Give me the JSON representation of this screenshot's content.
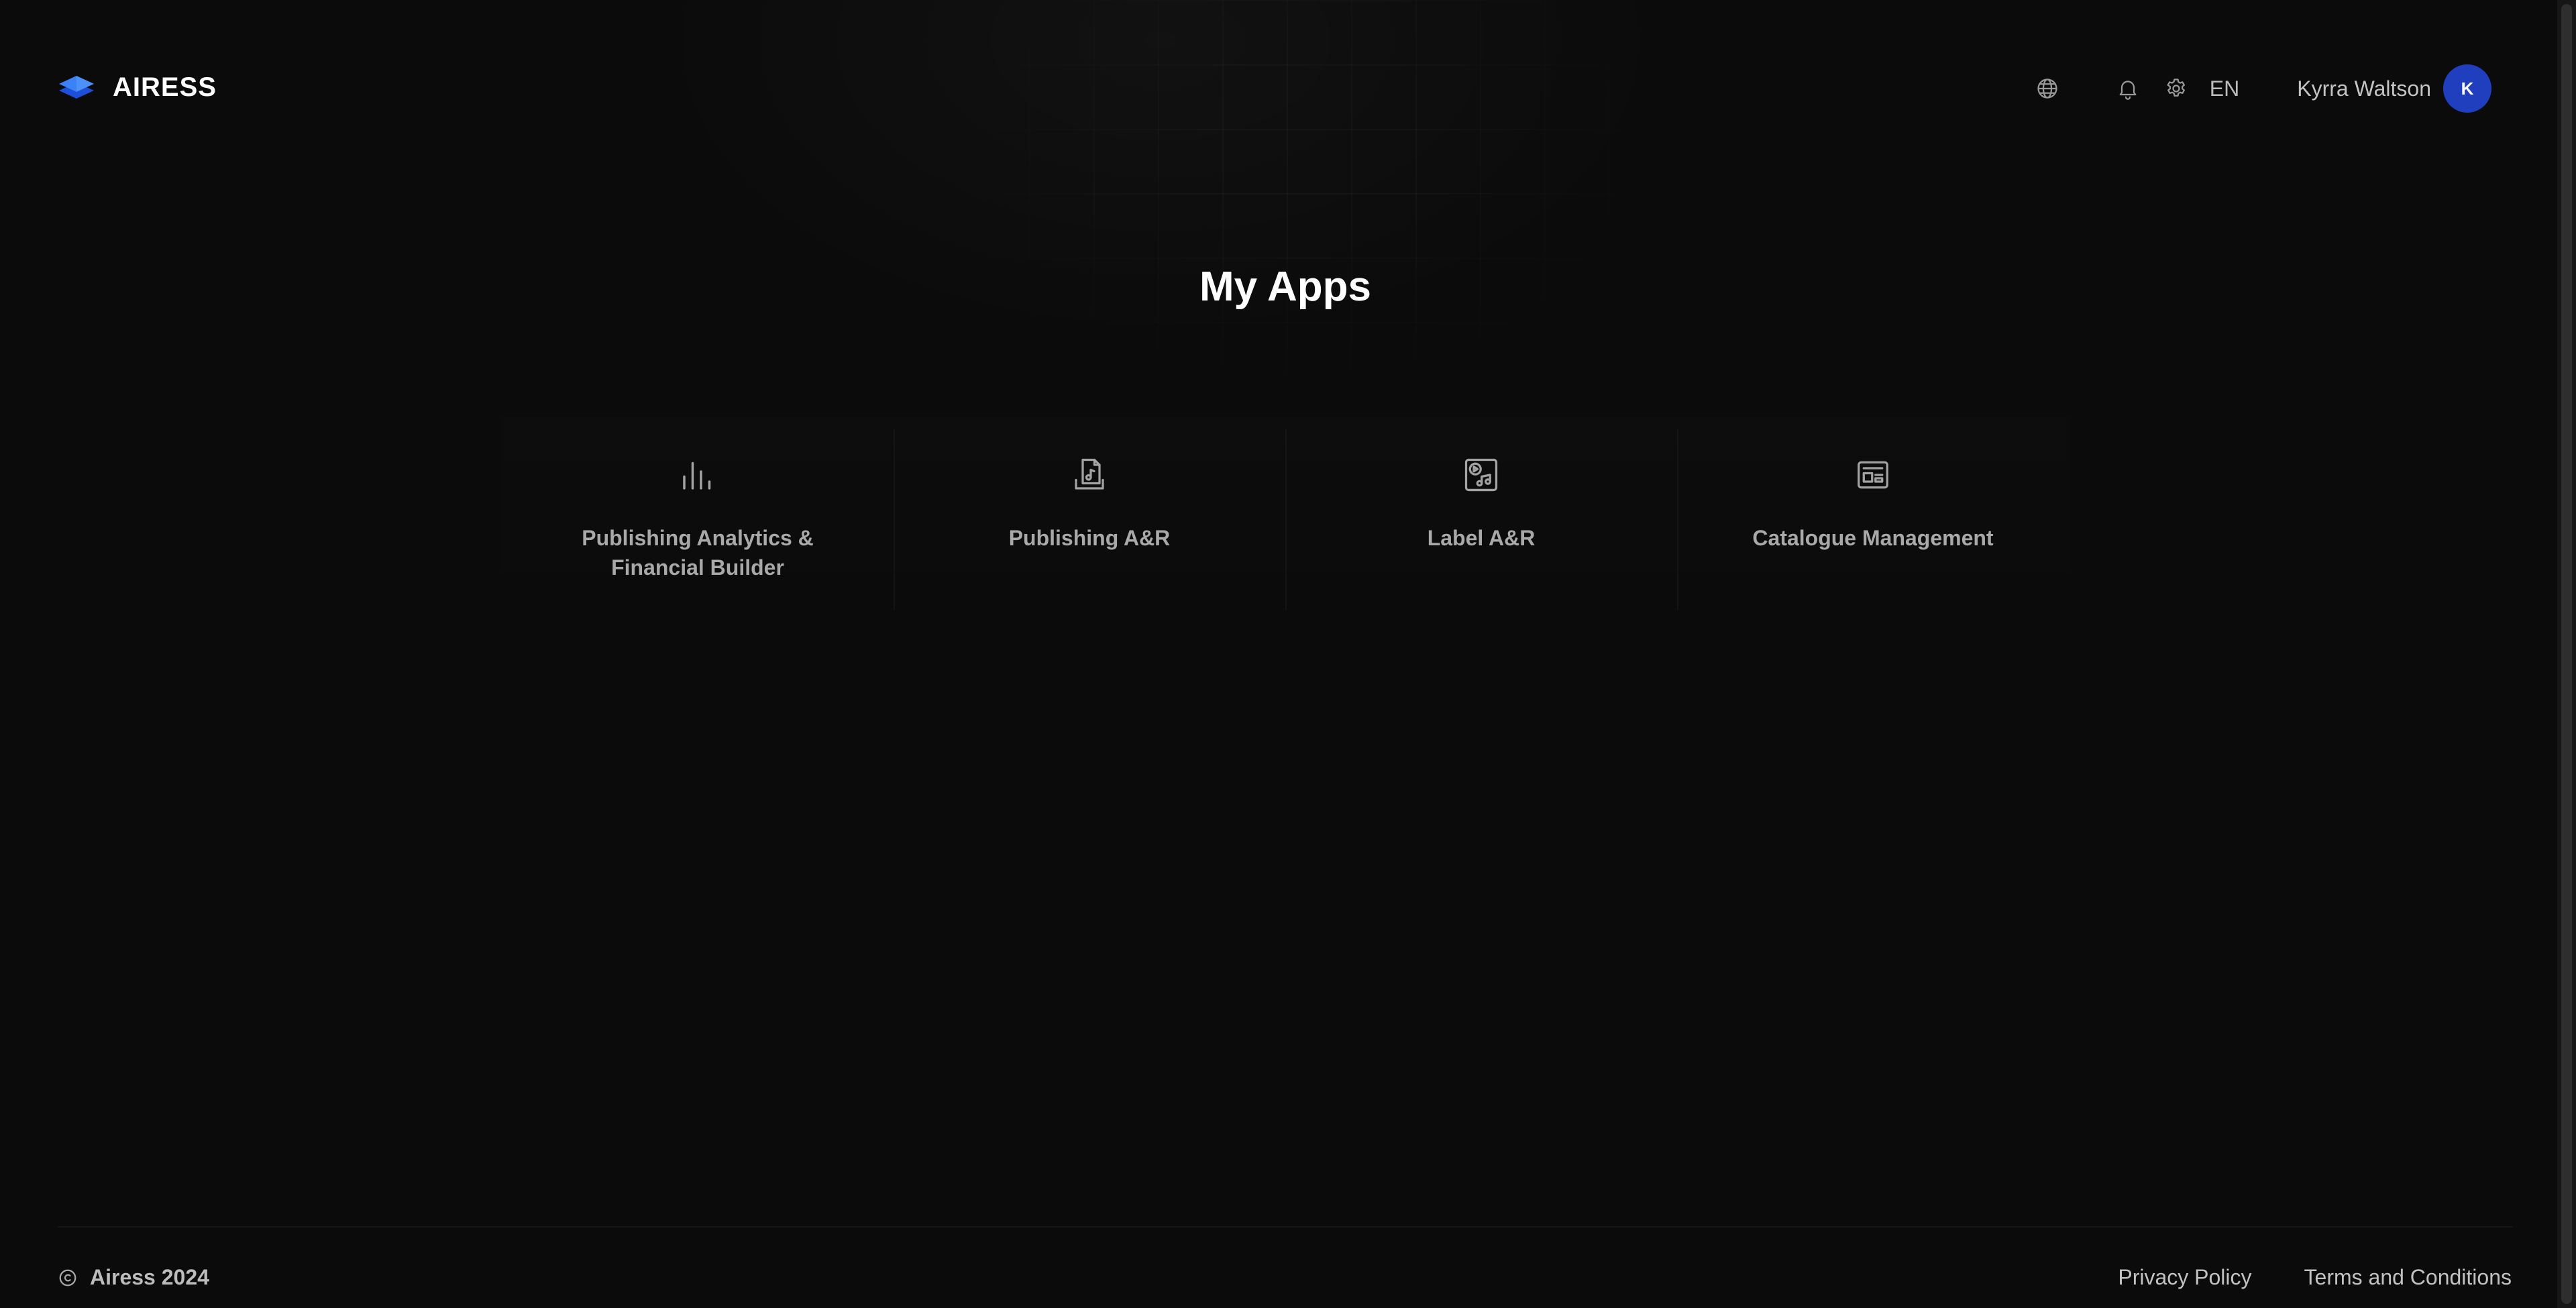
{
  "header": {
    "brand": {
      "name": "AIRESS",
      "logo_icon": "layers-logo-icon"
    },
    "actions": {
      "globe_icon": "globe-icon",
      "bell_icon": "bell-icon",
      "gear_icon": "gear-icon",
      "language": "EN"
    },
    "user": {
      "name": "Kyrra Waltson",
      "avatar_initial": "K",
      "avatar_color": "#1f3fbf"
    }
  },
  "main": {
    "title": "My Apps",
    "apps": [
      {
        "label": "Publishing Analytics & Financial Builder",
        "icon": "bar-chart-icon"
      },
      {
        "label": "Publishing A&R",
        "icon": "music-document-icon"
      },
      {
        "label": "Label A&R",
        "icon": "play-music-icon"
      },
      {
        "label": "Catalogue Management",
        "icon": "catalogue-icon"
      }
    ]
  },
  "footer": {
    "copyright": "Airess 2024",
    "links": [
      "Privacy Policy",
      "Terms and Conditions"
    ]
  },
  "colors": {
    "background": "#0b0b0b",
    "brand_accent": "#2f6bff",
    "avatar": "#1f3fbf"
  }
}
